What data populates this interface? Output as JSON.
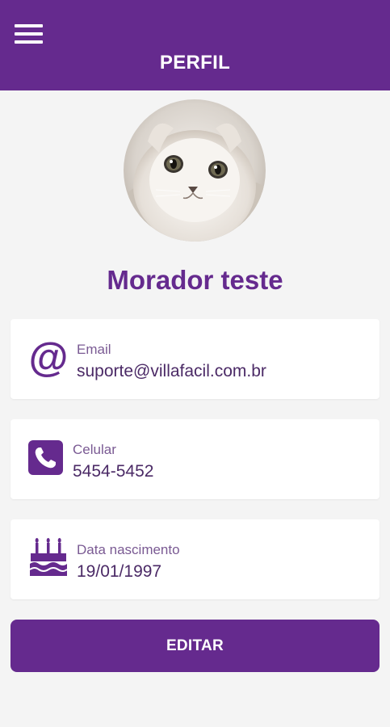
{
  "header": {
    "title": "PERFIL",
    "menu_icon": "hamburger-menu-icon"
  },
  "profile": {
    "name": "Morador teste",
    "avatar": "cat-photo"
  },
  "fields": [
    {
      "icon": "at-sign-icon",
      "label": "Email",
      "value": "suporte@villafacil.com.br"
    },
    {
      "icon": "phone-icon",
      "label": "Celular",
      "value": "5454-5452"
    },
    {
      "icon": "birthday-cake-icon",
      "label": "Data nascimento",
      "value": "19/01/1997"
    }
  ],
  "actions": {
    "edit_label": "EDITAR"
  },
  "colors": {
    "primary": "#652a8e",
    "background": "#f4f4f4",
    "card": "#ffffff"
  }
}
